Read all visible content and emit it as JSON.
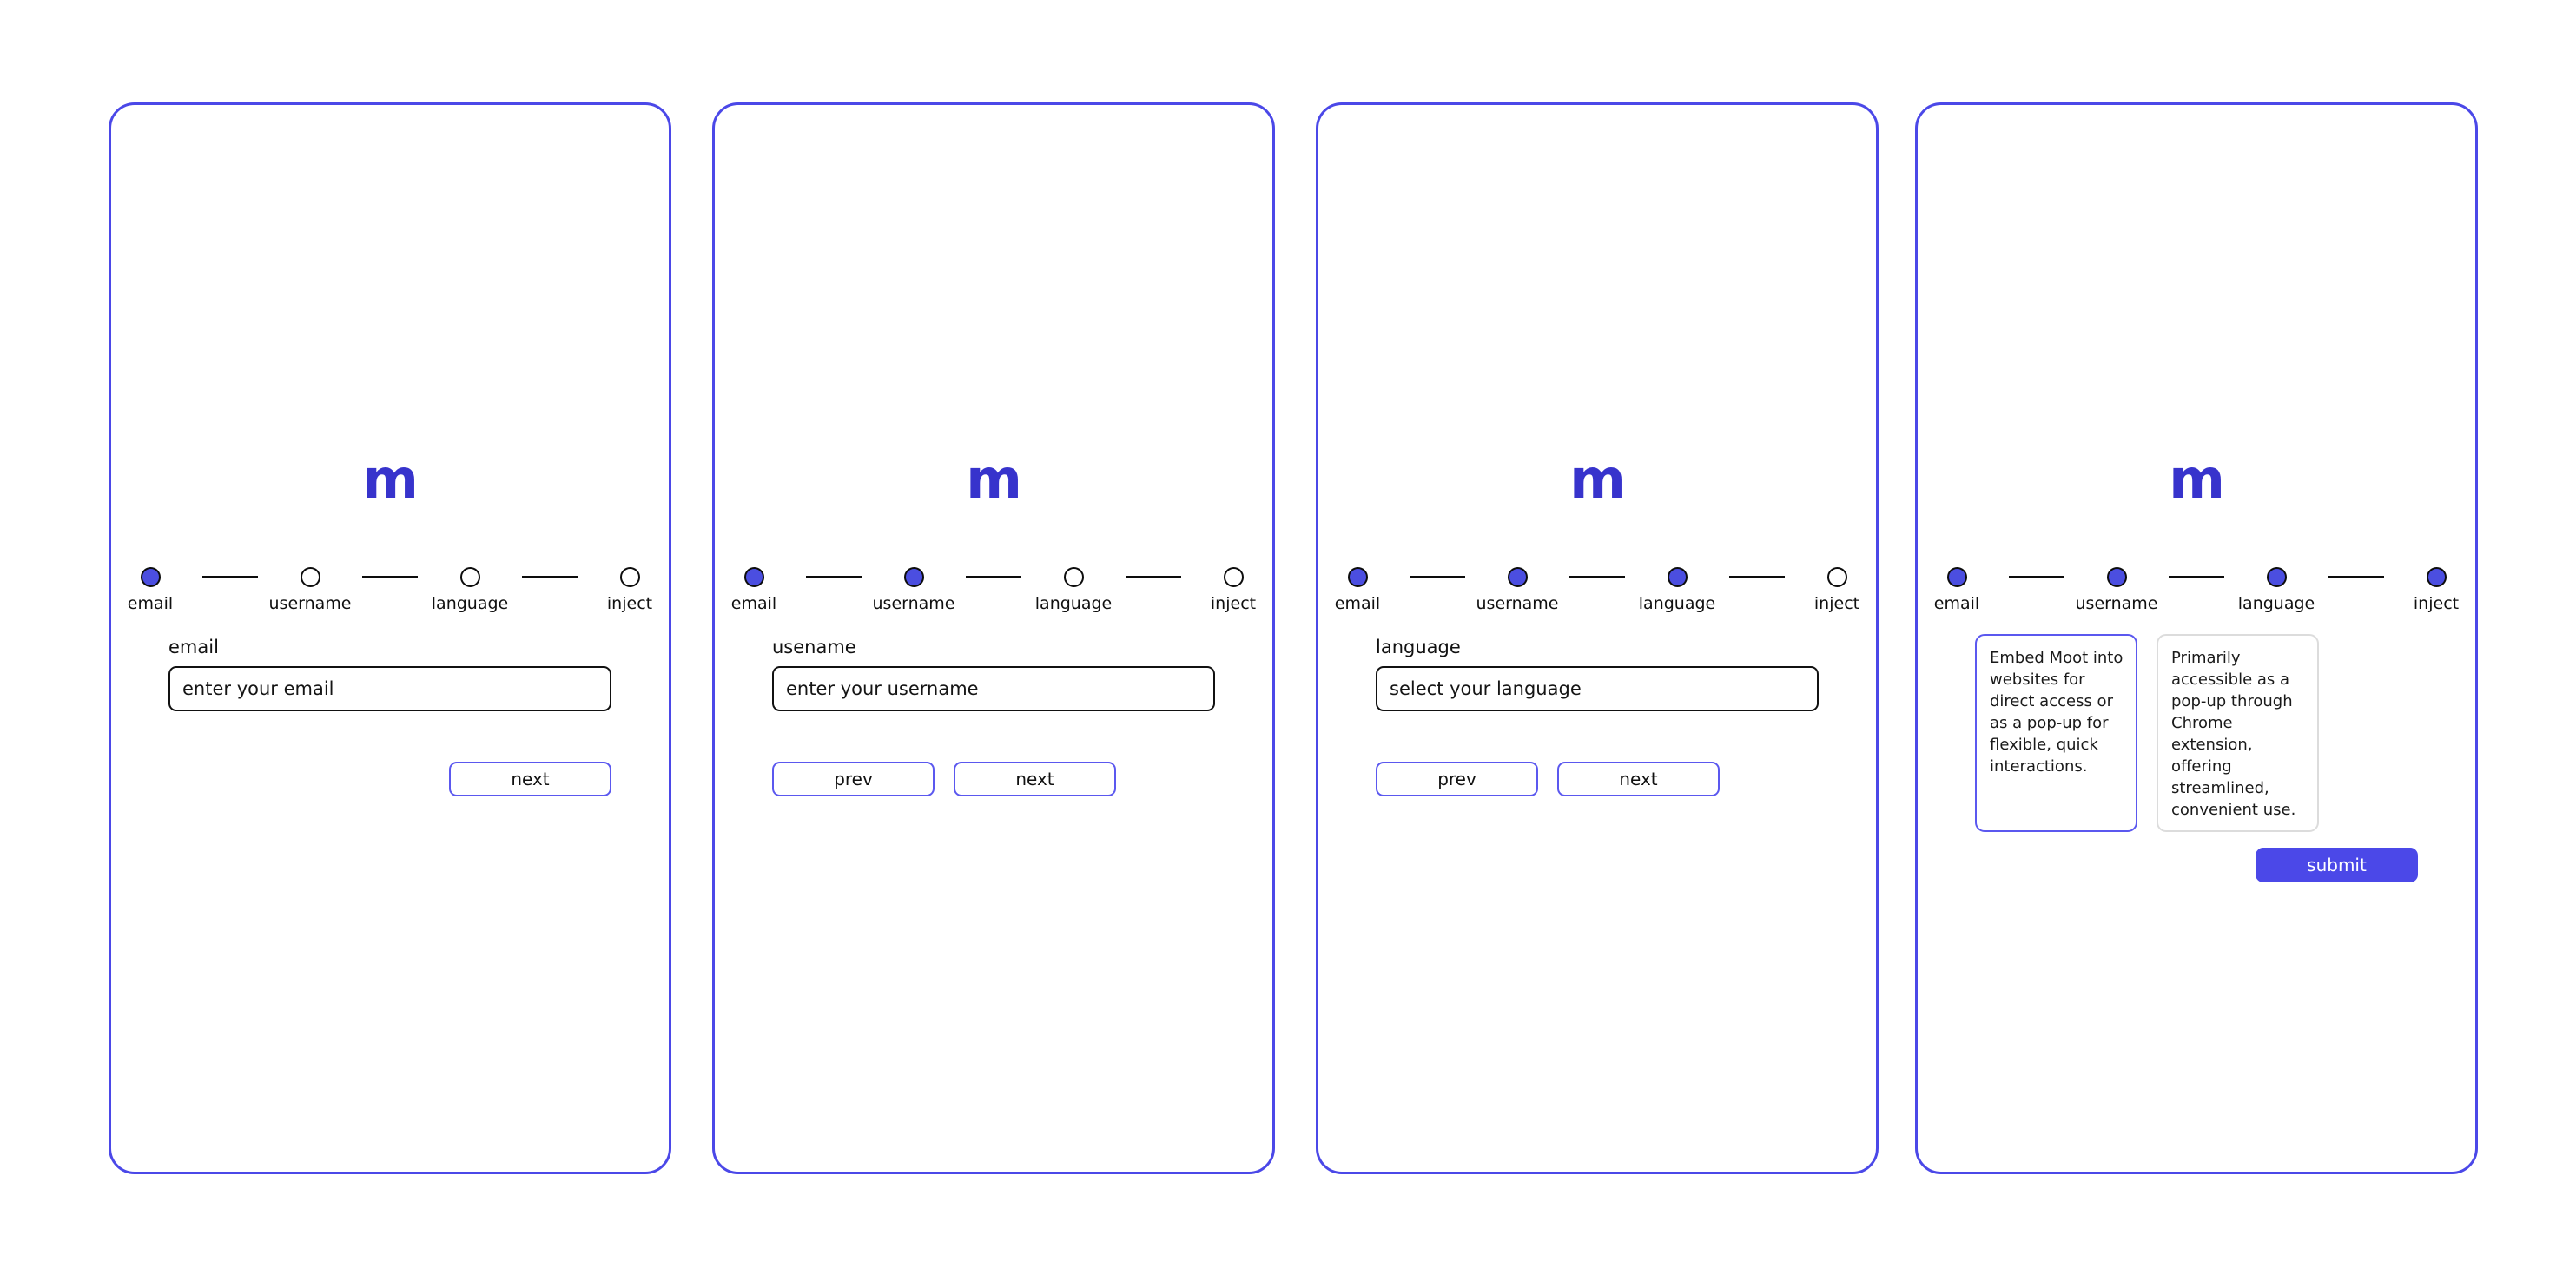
{
  "app": {
    "logo": "m",
    "brand_color": "#3733cc",
    "accent_color": "#4b48e8",
    "step_filled_color": "#4b4ee0",
    "card_unselected_border": "#dcdcdc",
    "background": "#ffffff"
  },
  "steps": {
    "email": "email",
    "username": "username",
    "language": "language",
    "inject": "inject"
  },
  "buttons": {
    "prev": "prev",
    "next": "next",
    "submit": "submit"
  },
  "screens": [
    {
      "name": "email-step",
      "active_step_index": 0,
      "field_label": "email",
      "field_value": "enter your email",
      "field_placeholder": "enter your email"
    },
    {
      "name": "username-step",
      "active_step_index": 1,
      "field_label": "usename",
      "field_value": "enter your username",
      "field_placeholder": "enter your username"
    },
    {
      "name": "language-step",
      "active_step_index": 2,
      "field_label": "language",
      "field_value": "select your language",
      "field_placeholder": "select your language"
    },
    {
      "name": "inject-step",
      "active_step_index": 3,
      "options": [
        {
          "text": "Embed Moot into websites for direct access or as a pop-up for flexible, quick interactions.",
          "selected": true
        },
        {
          "text": "Primarily accessible as a pop-up through Chrome extension, offering streamlined, convenient use.",
          "selected": false
        }
      ]
    }
  ]
}
